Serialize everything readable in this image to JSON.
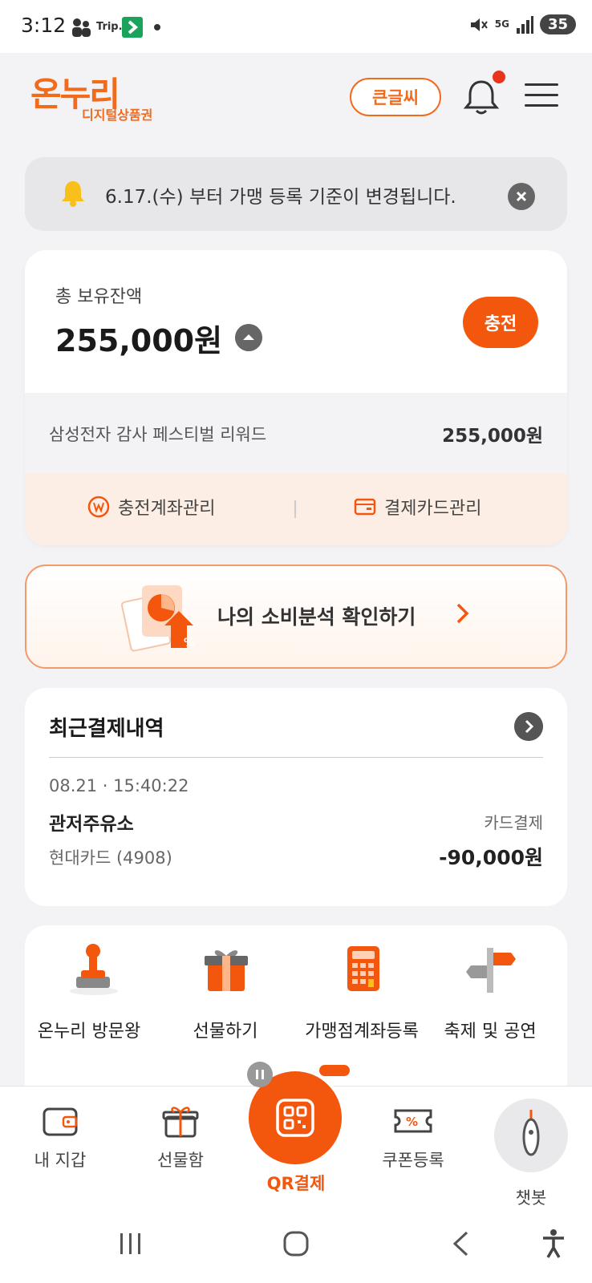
{
  "status_bar": {
    "time": "3:12",
    "trip_label": "Trip.",
    "network": "5G",
    "battery": "35"
  },
  "header": {
    "logo_main": "온누리",
    "logo_sub": "디지털상품권",
    "big_font_label": "큰글씨"
  },
  "notice": {
    "text": "6.17.(수) 부터 가맹 등록 기준이 변경됩니다."
  },
  "balance": {
    "label": "총 보유잔액",
    "amount": "255,000원",
    "charge_label": "충전",
    "reward_name": "삼성전자 감사 페스티벌 리워드",
    "reward_amount": "255,000원",
    "account_manage_label": "충전계좌관리",
    "card_manage_label": "결제카드관리"
  },
  "analysis": {
    "label": "나의 소비분석 확인하기"
  },
  "recent_payments": {
    "title": "최근결제내역",
    "transaction": {
      "time": "08.21 · 15:40:22",
      "store": "관저주유소",
      "method": "카드결제",
      "card": "현대카드 (4908)",
      "amount": "-90,000원"
    }
  },
  "quick_menu": {
    "items": [
      {
        "label": "온누리 방문왕",
        "icon": "stamp-icon"
      },
      {
        "label": "선물하기",
        "icon": "gift-box-icon"
      },
      {
        "label": "가맹점계좌등록",
        "icon": "calculator-icon"
      },
      {
        "label": "축제 및 공연",
        "icon": "signpost-icon"
      }
    ]
  },
  "bottom_nav": {
    "wallet": "내 지갑",
    "gift_box": "선물함",
    "qr_pay": "QR결제",
    "coupon": "쿠폰등록",
    "chatbot": "챗봇"
  },
  "colors": {
    "accent": "#f2570d",
    "logo": "#f26b1d",
    "notice_bg": "#e7e7ea",
    "manage_bg": "#fdeee5"
  }
}
